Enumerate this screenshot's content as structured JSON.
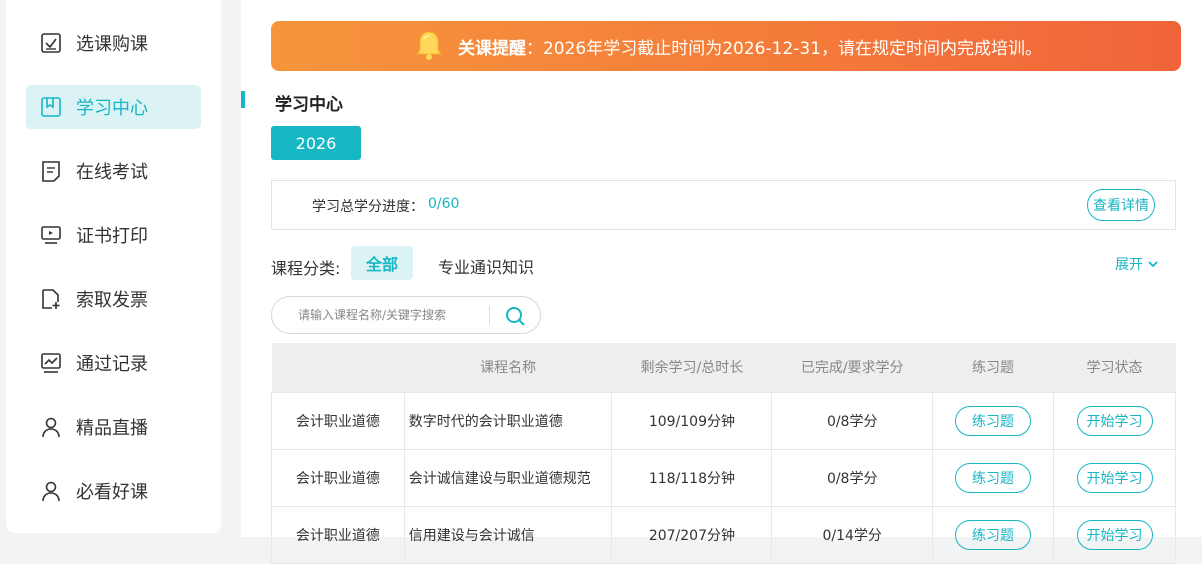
{
  "sidebar": {
    "items": [
      {
        "label": "选课购课",
        "icon": "checkbox-icon",
        "active": false
      },
      {
        "label": "学习中心",
        "icon": "bookmark-icon",
        "active": true
      },
      {
        "label": "在线考试",
        "icon": "document-icon",
        "active": false
      },
      {
        "label": "证书打印",
        "icon": "monitor-icon",
        "active": false
      },
      {
        "label": "索取发票",
        "icon": "file-add-icon",
        "active": false
      },
      {
        "label": "通过记录",
        "icon": "chart-icon",
        "active": false
      },
      {
        "label": "精品直播",
        "icon": "user-icon",
        "active": false
      },
      {
        "label": "必看好课",
        "icon": "user-icon",
        "active": false
      }
    ]
  },
  "banner": {
    "strong": "关课提醒",
    "text": "：2026年学习截止时间为2026-12-31，请在规定时间内完成培训。"
  },
  "page": {
    "title": "学习中心",
    "year": "2026",
    "progress_label": "学习总学分进度：",
    "progress_value": "0/60",
    "detail_button": "查看详情",
    "category_label": "课程分类:",
    "category_all": "全部",
    "category_other": "专业通识知识",
    "expand": "展开",
    "search_placeholder": "请输入课程名称/关键字搜索"
  },
  "table": {
    "headers": [
      "",
      "课程名称",
      "剩余学习/总时长",
      "已完成/要求学分",
      "练习题",
      "学习状态"
    ],
    "rows": [
      {
        "category": "会计职业道德",
        "name": "数字时代的会计职业道德",
        "duration": "109/109分钟",
        "credits": "0/8学分",
        "exercise": "练习题",
        "status": "开始学习"
      },
      {
        "category": "会计职业道德",
        "name": "会计诚信建设与职业道德规范",
        "duration": "118/118分钟",
        "credits": "0/8学分",
        "exercise": "练习题",
        "status": "开始学习"
      },
      {
        "category": "会计职业道德",
        "name": "信用建设与会计诚信",
        "duration": "207/207分钟",
        "credits": "0/14学分",
        "exercise": "练习题",
        "status": "开始学习"
      }
    ]
  },
  "colors": {
    "accent": "#17b6c5",
    "banner_start": "#f6953c",
    "banner_end": "#f0633a"
  }
}
